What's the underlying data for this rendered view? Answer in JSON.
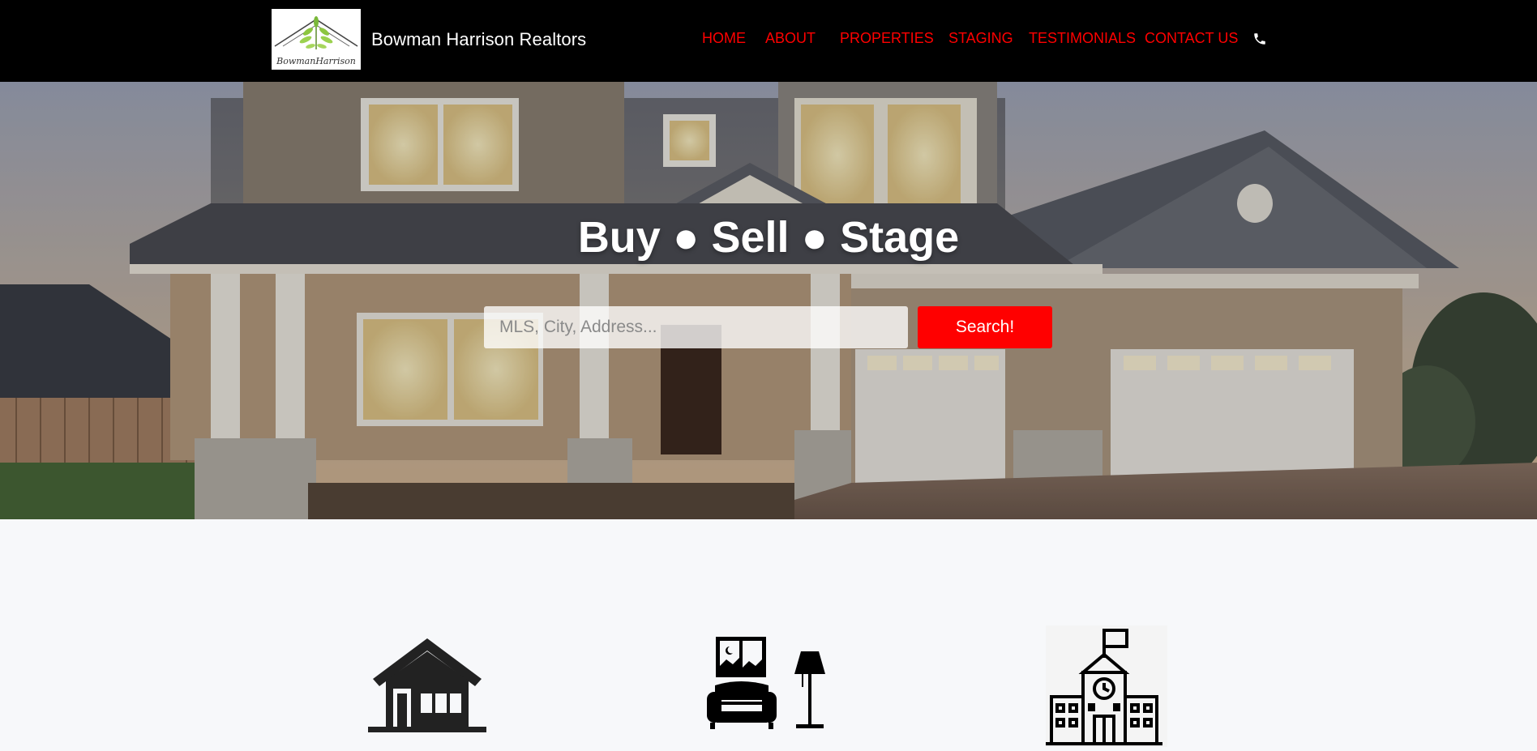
{
  "brand": {
    "name": "Bowman Harrison Realtors",
    "logo_text": "BowmanHarrison"
  },
  "nav": {
    "items": [
      {
        "label": "HOME"
      },
      {
        "label": "ABOUT"
      },
      {
        "label": "PROPERTIES"
      },
      {
        "label": "STAGING"
      },
      {
        "label": "TESTIMONIALS"
      },
      {
        "label": "CONTACT US"
      }
    ],
    "phone_icon": "phone-icon"
  },
  "hero": {
    "title": "Buy ● Sell ● Stage",
    "search": {
      "placeholder": "MLS, City, Address...",
      "value": ""
    },
    "search_button": "Search!"
  },
  "features": {
    "icons": [
      "house-icon",
      "sofa-lamp-icon",
      "school-building-icon"
    ]
  },
  "colors": {
    "nav_bg": "#000000",
    "nav_link": "#ff0000",
    "accent": "#ff0000",
    "page_bg": "#f7f8fa"
  }
}
